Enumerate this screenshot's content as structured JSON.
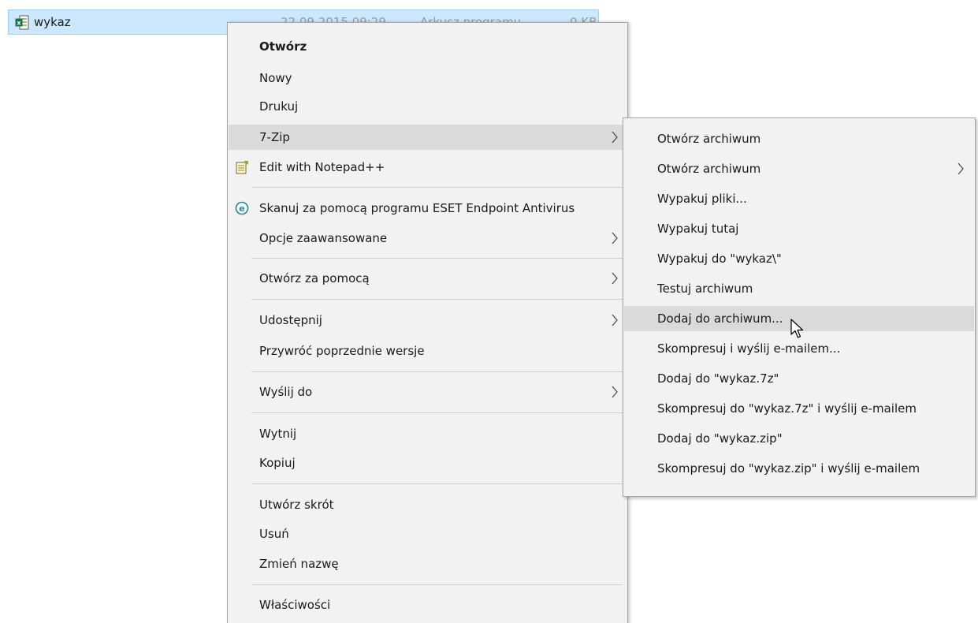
{
  "file": {
    "name": "wykaz",
    "date": "22.09.2015 09:29",
    "type": "Arkusz programu",
    "size": "0 KB",
    "icon": "excel-file-icon",
    "selected_color": "#cce8ff"
  },
  "context_menu": {
    "items": [
      {
        "label": "Otwórz"
      },
      {
        "label": "Nowy"
      },
      {
        "label": "Drukuj"
      },
      {
        "label": "7-Zip"
      },
      {
        "label": "Edit with Notepad++",
        "icon": "notepad-plus-plus-icon"
      },
      {
        "label": "Skanuj za pomocą programu ESET Endpoint Antivirus",
        "icon": "eset-icon"
      },
      {
        "label": "Opcje zaawansowane"
      },
      {
        "label": "Otwórz za pomocą"
      },
      {
        "label": "Udostępnij"
      },
      {
        "label": "Przywróć poprzednie wersje"
      },
      {
        "label": "Wyślij do"
      },
      {
        "label": "Wytnij"
      },
      {
        "label": "Kopiuj"
      },
      {
        "label": "Utwórz skrót"
      },
      {
        "label": "Usuń"
      },
      {
        "label": "Zmień nazwę"
      },
      {
        "label": "Właściwości"
      }
    ]
  },
  "submenu_7zip": {
    "items": [
      {
        "label": "Otwórz archiwum"
      },
      {
        "label": "Otwórz archiwum"
      },
      {
        "label": "Wypakuj pliki..."
      },
      {
        "label": "Wypakuj tutaj"
      },
      {
        "label": "Wypakuj do \"wykaz\\\""
      },
      {
        "label": "Testuj archiwum"
      },
      {
        "label": "Dodaj do archiwum..."
      },
      {
        "label": "Skompresuj i wyślij e-mailem..."
      },
      {
        "label": "Dodaj do \"wykaz.7z\""
      },
      {
        "label": "Skompresuj do \"wykaz.7z\" i wyślij e-mailem"
      },
      {
        "label": "Dodaj do \"wykaz.zip\""
      },
      {
        "label": "Skompresuj do \"wykaz.zip\" i wyślij e-mailem"
      }
    ]
  },
  "colors": {
    "menu_background": "#f2f2f2",
    "menu_hover": "#dadada",
    "separator": "#cfcfcf"
  }
}
